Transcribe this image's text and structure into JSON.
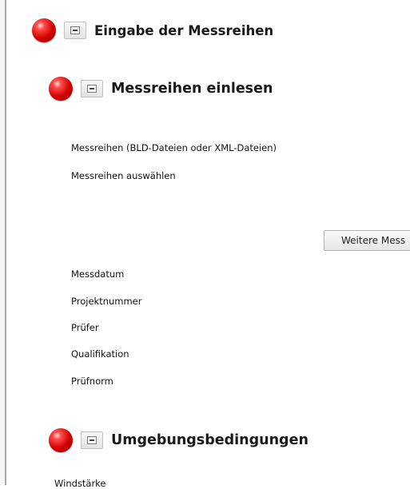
{
  "sections": {
    "main": {
      "title": "Eingabe der Messreihen",
      "status": "error",
      "state": "expanded"
    },
    "import": {
      "title": "Messreihen einlesen",
      "status": "error",
      "state": "expanded"
    },
    "environment": {
      "title": "Umgebungsbedingungen",
      "status": "error",
      "state": "expanded"
    }
  },
  "import_fields": {
    "series_label": "Messreihen (BLD-Dateien oder XML-Dateien)",
    "select_label": "Messreihen auswählen",
    "more_button_label": "Weitere Mess"
  },
  "metadata_fields": [
    "Messdatum",
    "Projektnummer",
    "Prüfer",
    "Qualifikation",
    "Prüfnorm"
  ],
  "environment_fields": {
    "wind_label": "Windstärke"
  },
  "colors": {
    "status_error": "#d40000",
    "title_text": "#1a1a1a",
    "border": "#a9a9a9"
  },
  "icons": {
    "status": "red-status-dot-icon",
    "collapse": "minus-icon"
  }
}
